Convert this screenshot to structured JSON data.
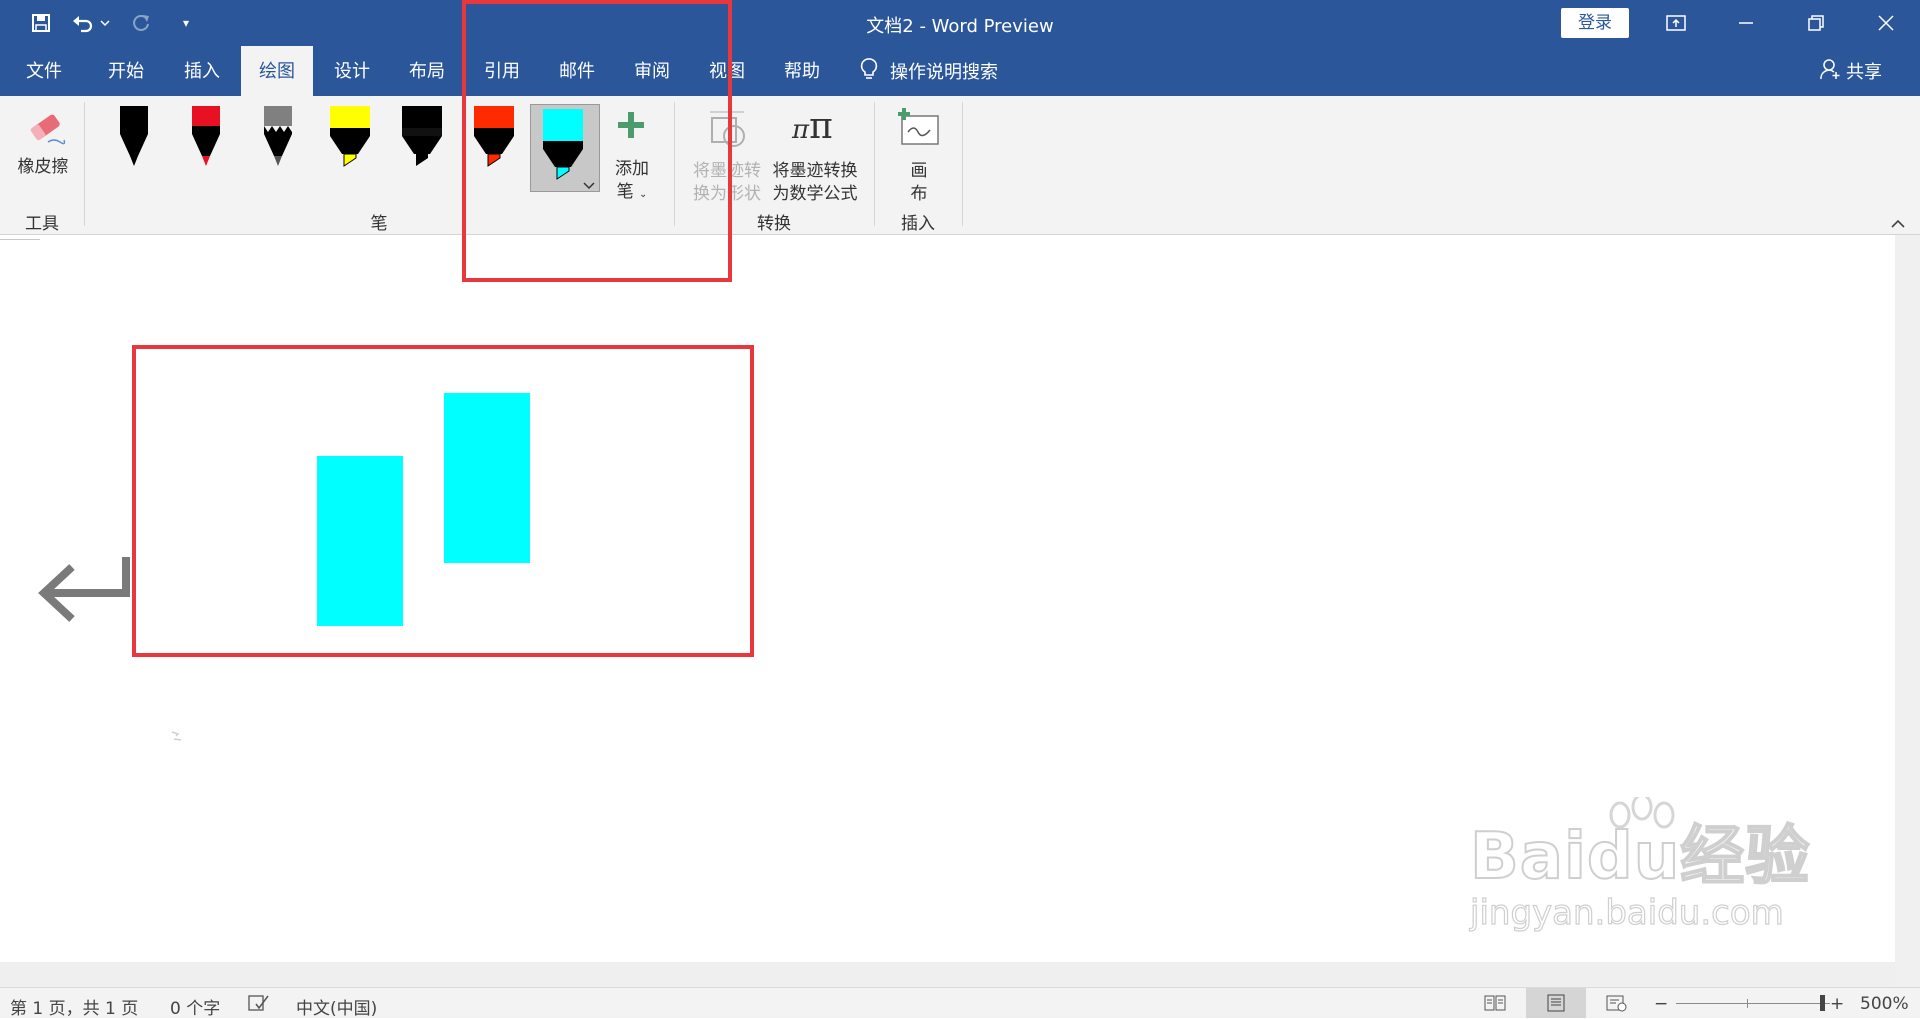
{
  "titlebar": {
    "doc_title": "文档2  -  Word Preview",
    "login_label": "登录",
    "qa_customize_symbol": "▾"
  },
  "tabs": [
    {
      "label": "文件"
    },
    {
      "label": "开始"
    },
    {
      "label": "插入"
    },
    {
      "label": "绘图",
      "active": true
    },
    {
      "label": "设计"
    },
    {
      "label": "布局"
    },
    {
      "label": "引用"
    },
    {
      "label": "邮件"
    },
    {
      "label": "审阅"
    },
    {
      "label": "视图"
    },
    {
      "label": "帮助"
    }
  ],
  "tell_me": "操作说明搜索",
  "share": "共享",
  "ribbon": {
    "eraser_label": "橡皮擦",
    "group_tools": "工具",
    "group_pens": "笔",
    "add_pen_label_1": "添加",
    "add_pen_label_2": "笔",
    "ink_to_shape_label_1": "将墨迹转",
    "ink_to_shape_label_2": "换为形状",
    "ink_to_math_label_1": "将墨迹转换",
    "ink_to_math_label_2": "为数学公式",
    "group_convert": "转换",
    "canvas_label_1": "画",
    "canvas_label_2": "布",
    "group_insert": "插入",
    "pens": [
      {
        "name": "black-pen",
        "color": "#000000"
      },
      {
        "name": "red-pen",
        "color": "#e81123"
      },
      {
        "name": "gray-pencil",
        "color": "#808080"
      },
      {
        "name": "yellow-highlighter",
        "color": "#ffff00"
      },
      {
        "name": "black-highlighter",
        "color": "#000000"
      },
      {
        "name": "red-highlighter",
        "color": "#ff2a00"
      },
      {
        "name": "cyan-highlighter",
        "color": "#00ffff",
        "selected": true
      }
    ]
  },
  "document": {
    "highlight_color": "#00ffff",
    "annotation_color": "#e8383d"
  },
  "status": {
    "page": "第 1 页，共 1 页",
    "words": "0 个字",
    "language": "中文(中国)",
    "zoom": "500%"
  },
  "watermark": {
    "brand": "Baidu经验",
    "url": "jingyan.baidu.com"
  }
}
